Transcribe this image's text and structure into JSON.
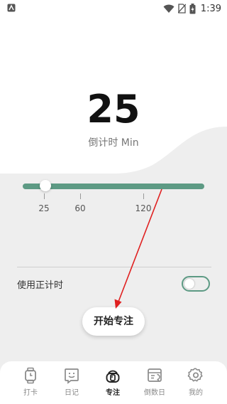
{
  "status_bar": {
    "time": "1:39",
    "icons": [
      "app-notification-icon",
      "wifi-icon",
      "no-sim-icon",
      "battery-charging-icon"
    ]
  },
  "timer": {
    "value": "25",
    "caption": "倒计时 Min"
  },
  "slider": {
    "value_minutes": 25,
    "ticks": [
      "25",
      "60",
      "120"
    ]
  },
  "options": {
    "countup_label": "使用正计时",
    "countup_enabled": false
  },
  "actions": {
    "start_label": "开始专注"
  },
  "tabs": [
    {
      "label": "打卡",
      "icon": "watch-icon",
      "active": false
    },
    {
      "label": "日记",
      "icon": "diary-face-icon",
      "active": false
    },
    {
      "label": "专注",
      "icon": "focus-timer-icon",
      "active": true
    },
    {
      "label": "倒数日",
      "icon": "countdown-calendar-icon",
      "active": false
    },
    {
      "label": "我的",
      "icon": "gear-icon",
      "active": false
    }
  ],
  "colors": {
    "accent": "#5d9a84",
    "annotation_arrow": "#e02020",
    "background": "#eeeeee"
  }
}
